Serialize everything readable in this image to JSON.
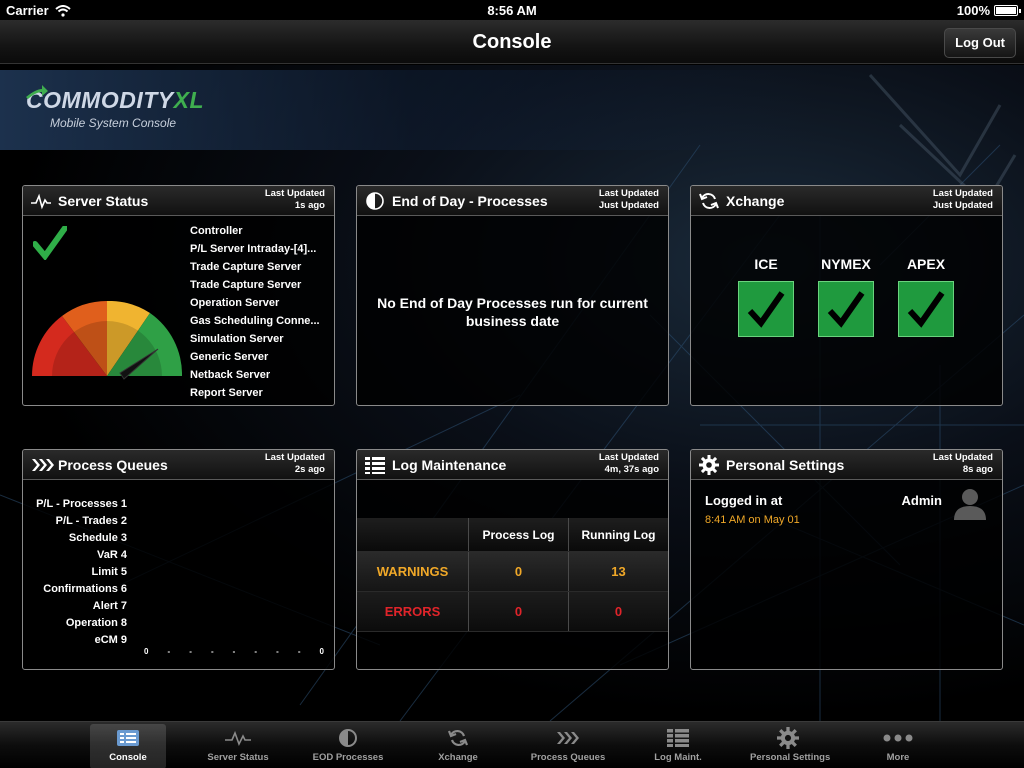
{
  "status_bar": {
    "carrier": "Carrier",
    "time": "8:56 AM",
    "battery": "100%"
  },
  "nav": {
    "title": "Console",
    "logout_label": "Log Out"
  },
  "brand": {
    "name_main": "COMMODITY",
    "name_accent": "XL",
    "subtitle": "Mobile System Console"
  },
  "panels": {
    "server_status": {
      "title": "Server Status",
      "last_updated_label": "Last Updated",
      "last_updated_value": "1s ago",
      "servers": [
        "Controller",
        "P/L Server Intraday-[4]...",
        "Trade Capture Server",
        "Trade Capture Server",
        "Operation Server",
        "Gas Scheduling Conne...",
        "Simulation Server",
        "Generic Server",
        "Netback Server",
        "Report Server"
      ]
    },
    "eod": {
      "title": "End of Day - Processes",
      "last_updated_label": "Last Updated",
      "last_updated_value": "Just Updated",
      "message": "No End of Day Processes run for current business date"
    },
    "xchange": {
      "title": "Xchange",
      "last_updated_label": "Last Updated",
      "last_updated_value": "Just Updated",
      "exchanges": [
        "ICE",
        "NYMEX",
        "APEX"
      ]
    },
    "process_queues": {
      "title": "Process Queues",
      "last_updated_label": "Last Updated",
      "last_updated_value": "2s ago",
      "queues": [
        "P/L - Processes 1",
        "P/L - Trades 2",
        "Schedule 3",
        "VaR 4",
        "Limit 5",
        "Confirmations 6",
        "Alert 7",
        "Operation 8",
        "eCM 9"
      ],
      "axis_start": "0",
      "axis_end": "0",
      "axis_tick": "-"
    },
    "log_maintenance": {
      "title": "Log Maintenance",
      "last_updated_label": "Last Updated",
      "last_updated_value": "4m, 37s ago",
      "col_process": "Process Log",
      "col_running": "Running Log",
      "rows": [
        {
          "label": "WARNINGS",
          "process": "0",
          "running": "13"
        },
        {
          "label": "ERRORS",
          "process": "0",
          "running": "0"
        }
      ]
    },
    "personal": {
      "title": "Personal Settings",
      "last_updated_label": "Last Updated",
      "last_updated_value": "8s ago",
      "logged_in_label": "Logged in at",
      "logged_in_time": "8:41 AM on May 01",
      "user": "Admin"
    }
  },
  "tabs": [
    {
      "label": "Console",
      "icon": "console-icon"
    },
    {
      "label": "Server Status",
      "icon": "pulse-icon"
    },
    {
      "label": "EOD Processes",
      "icon": "half-circle-icon"
    },
    {
      "label": "Xchange",
      "icon": "sync-icon"
    },
    {
      "label": "Process Queues",
      "icon": "chevrons-icon"
    },
    {
      "label": "Log Maint.",
      "icon": "list-icon"
    },
    {
      "label": "Personal Settings",
      "icon": "gear-icon"
    },
    {
      "label": "More",
      "icon": "more-icon"
    }
  ],
  "colors": {
    "accent_green": "#1f9a3e",
    "warning": "#f0a828",
    "error": "#e0242a"
  }
}
